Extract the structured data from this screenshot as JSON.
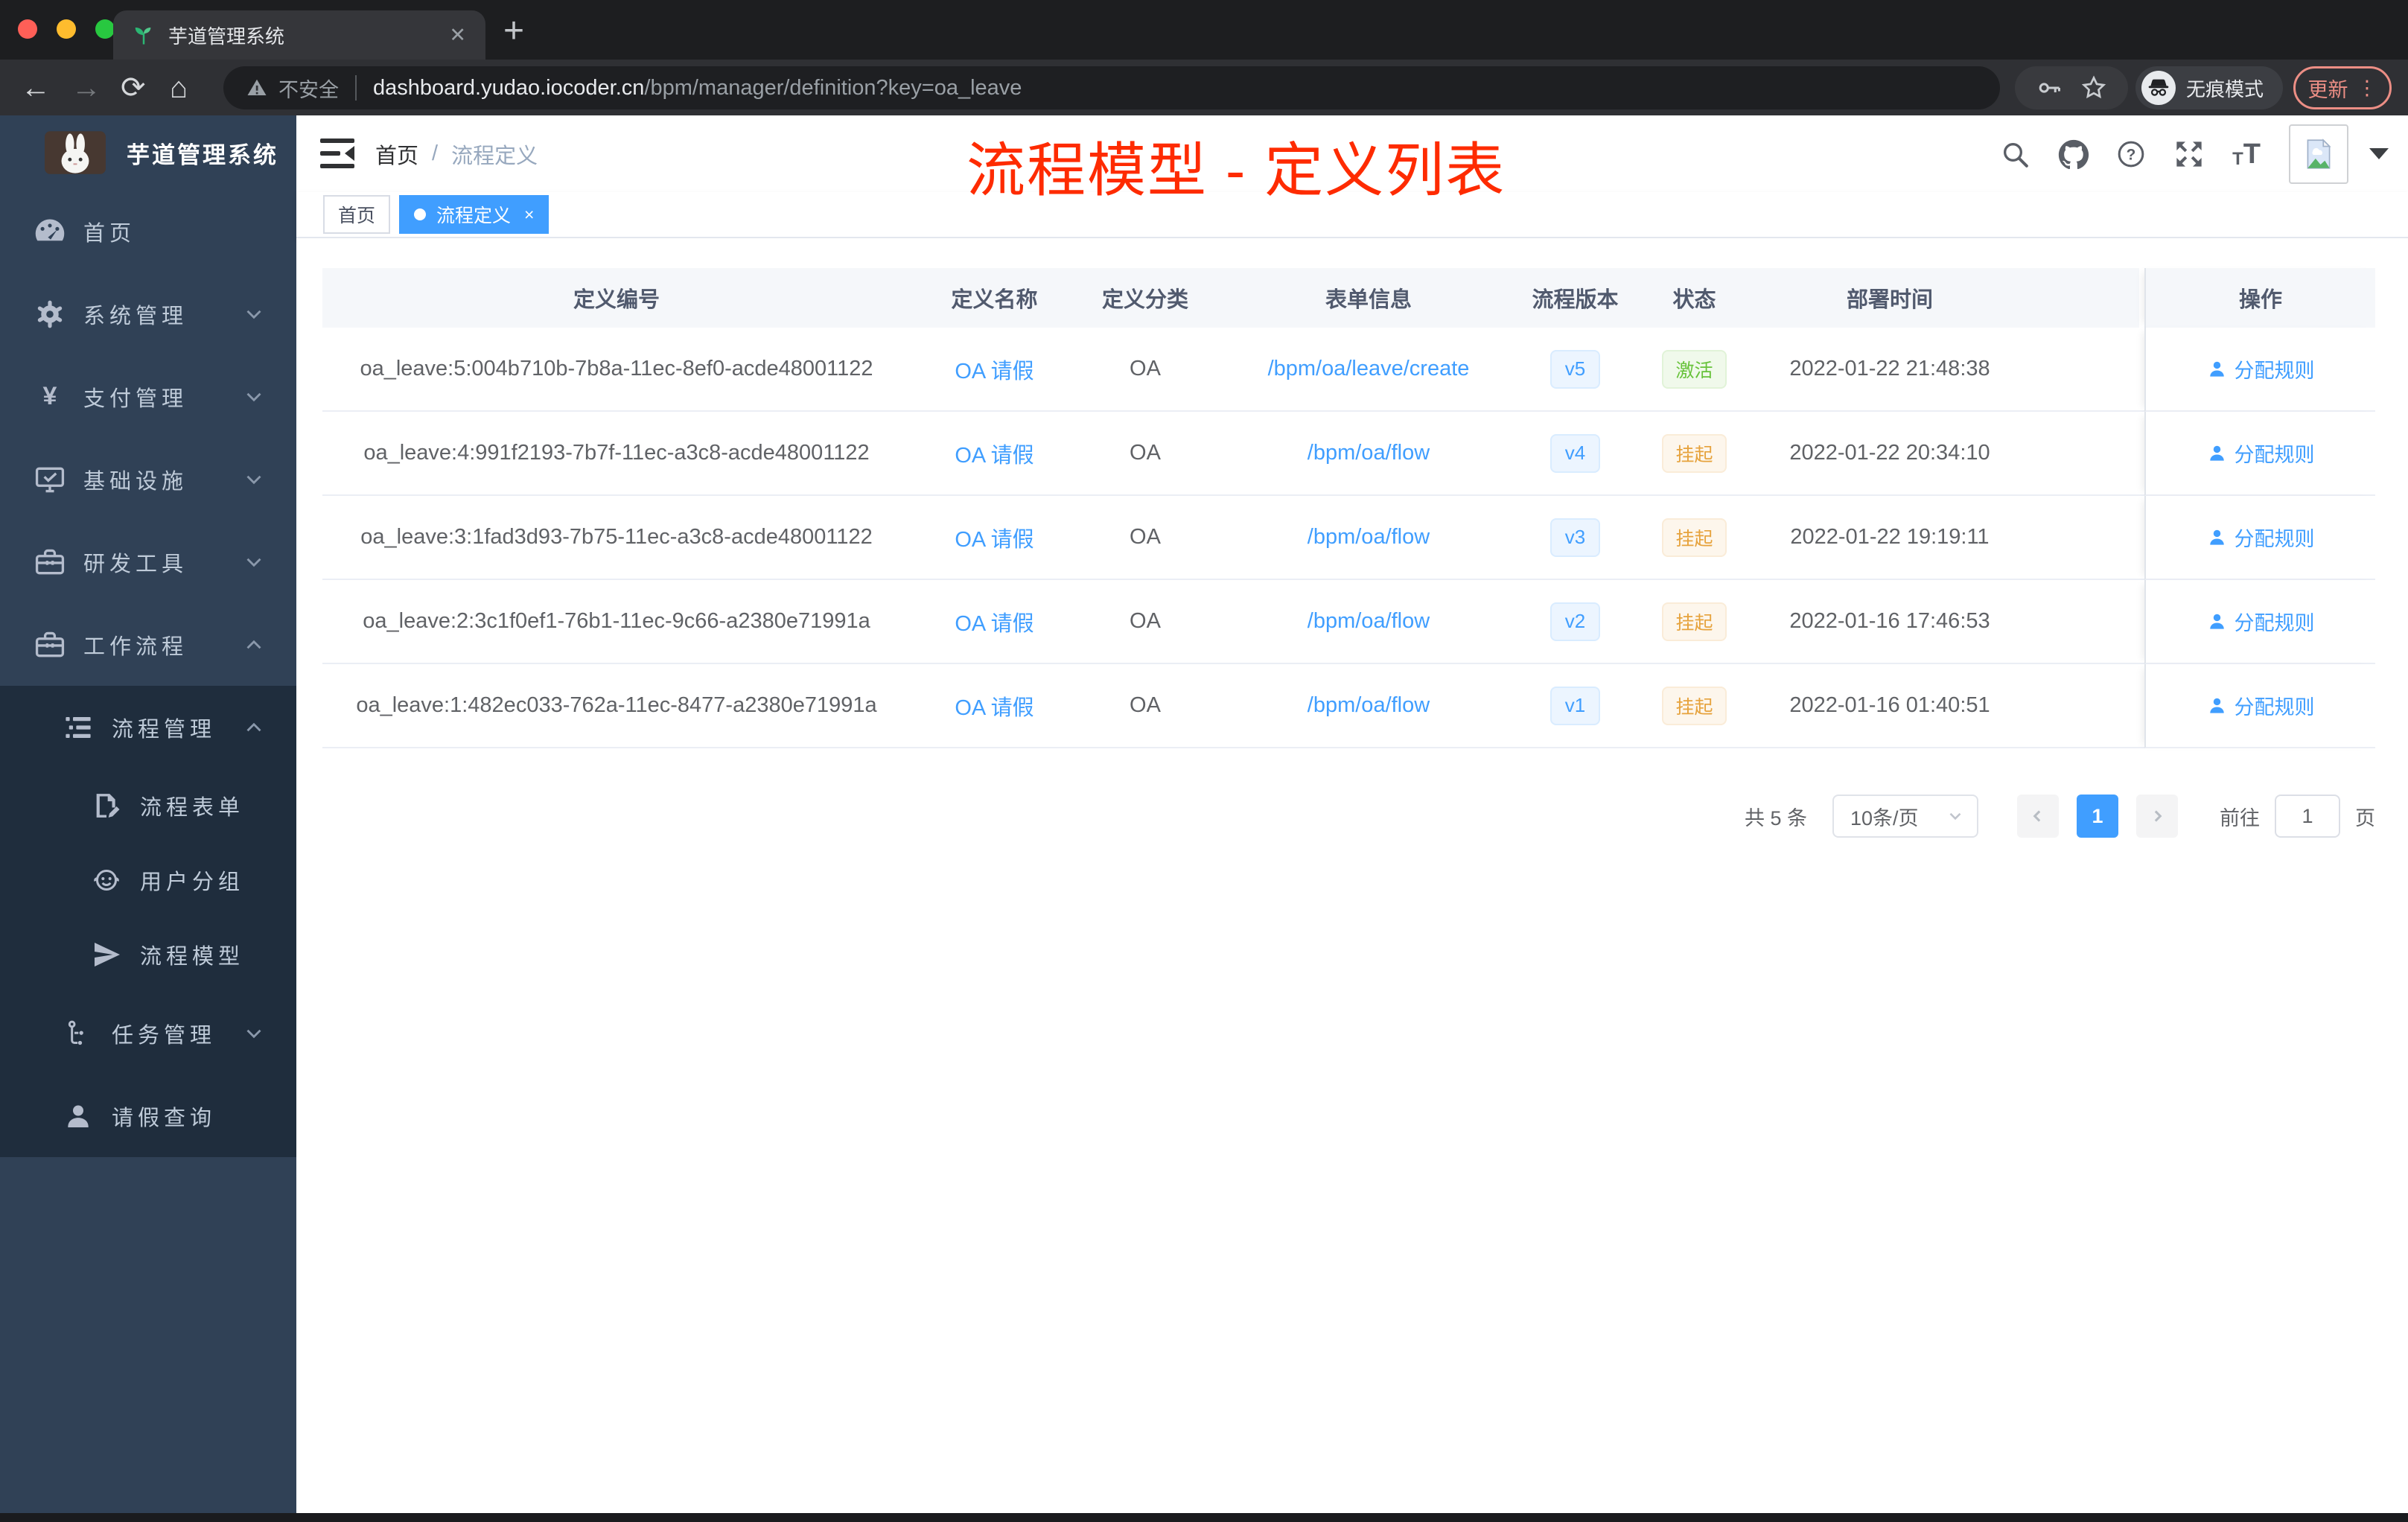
{
  "browser": {
    "tab": {
      "title": "芋道管理系统",
      "close": "✕",
      "new_tab": "+"
    },
    "nav": {
      "back": "←",
      "forward": "→",
      "reload": "⟳",
      "home": "⌂"
    },
    "address": {
      "security": "不安全",
      "domain": "dashboard.yudao.iocoder.cn",
      "path": "/bpm/manager/definition?key=oa_leave"
    },
    "incognito_label": "无痕模式",
    "update_label": "更新",
    "menu_dots": "⋮"
  },
  "sidebar": {
    "title": "芋道管理系统",
    "items": [
      {
        "label": "首页"
      },
      {
        "label": "系统管理"
      },
      {
        "label": "支付管理"
      },
      {
        "label": "基础设施"
      },
      {
        "label": "研发工具"
      },
      {
        "label": "工作流程"
      },
      {
        "label": "流程管理"
      },
      {
        "label": "流程表单"
      },
      {
        "label": "用户分组"
      },
      {
        "label": "流程模型"
      },
      {
        "label": "任务管理"
      },
      {
        "label": "请假查询"
      }
    ],
    "pay_icon": "¥"
  },
  "navbar": {
    "breadcrumb": {
      "home": "首页",
      "separator": "/",
      "current": "流程定义"
    }
  },
  "tags": {
    "home": "首页",
    "active": "流程定义",
    "close": "×"
  },
  "annotation": {
    "text": "流程模型 - 定义列表",
    "color": "#fe2b00"
  },
  "table": {
    "headers": [
      "定义编号",
      "定义名称",
      "定义分类",
      "表单信息",
      "流程版本",
      "状态",
      "部署时间",
      "操作"
    ],
    "rows": [
      {
        "id": "oa_leave:5:004b710b-7b8a-11ec-8ef0-acde48001122",
        "name": "OA 请假",
        "category": "OA",
        "form": "/bpm/oa/leave/create",
        "version": "v5",
        "status": "激活",
        "time": "2022-01-22 21:48:38",
        "action": "分配规则"
      },
      {
        "id": "oa_leave:4:991f2193-7b7f-11ec-a3c8-acde48001122",
        "name": "OA 请假",
        "category": "OA",
        "form": "/bpm/oa/flow",
        "version": "v4",
        "status": "挂起",
        "time": "2022-01-22 20:34:10",
        "action": "分配规则"
      },
      {
        "id": "oa_leave:3:1fad3d93-7b75-11ec-a3c8-acde48001122",
        "name": "OA 请假",
        "category": "OA",
        "form": "/bpm/oa/flow",
        "version": "v3",
        "status": "挂起",
        "time": "2022-01-22 19:19:11",
        "action": "分配规则"
      },
      {
        "id": "oa_leave:2:3c1f0ef1-76b1-11ec-9c66-a2380e71991a",
        "name": "OA 请假",
        "category": "OA",
        "form": "/bpm/oa/flow",
        "version": "v2",
        "status": "挂起",
        "time": "2022-01-16 17:46:53",
        "action": "分配规则"
      },
      {
        "id": "oa_leave:1:482ec033-762a-11ec-8477-a2380e71991a",
        "name": "OA 请假",
        "category": "OA",
        "form": "/bpm/oa/flow",
        "version": "v1",
        "status": "挂起",
        "time": "2022-01-16 01:40:51",
        "action": "分配规则"
      }
    ]
  },
  "pagination": {
    "total": "共 5 条",
    "page_size": "10条/页",
    "prev": "‹",
    "current": "1",
    "next": "›",
    "goto_label": "前往",
    "goto_value": "1",
    "unit": "页"
  },
  "colors": {
    "accent": "#409eff",
    "success": "#67c23a",
    "warning": "#e6a23c",
    "annotation_red": "#fe2b00",
    "sidebar_bg": "#304156",
    "submenu_bg": "#1f2d3d"
  }
}
